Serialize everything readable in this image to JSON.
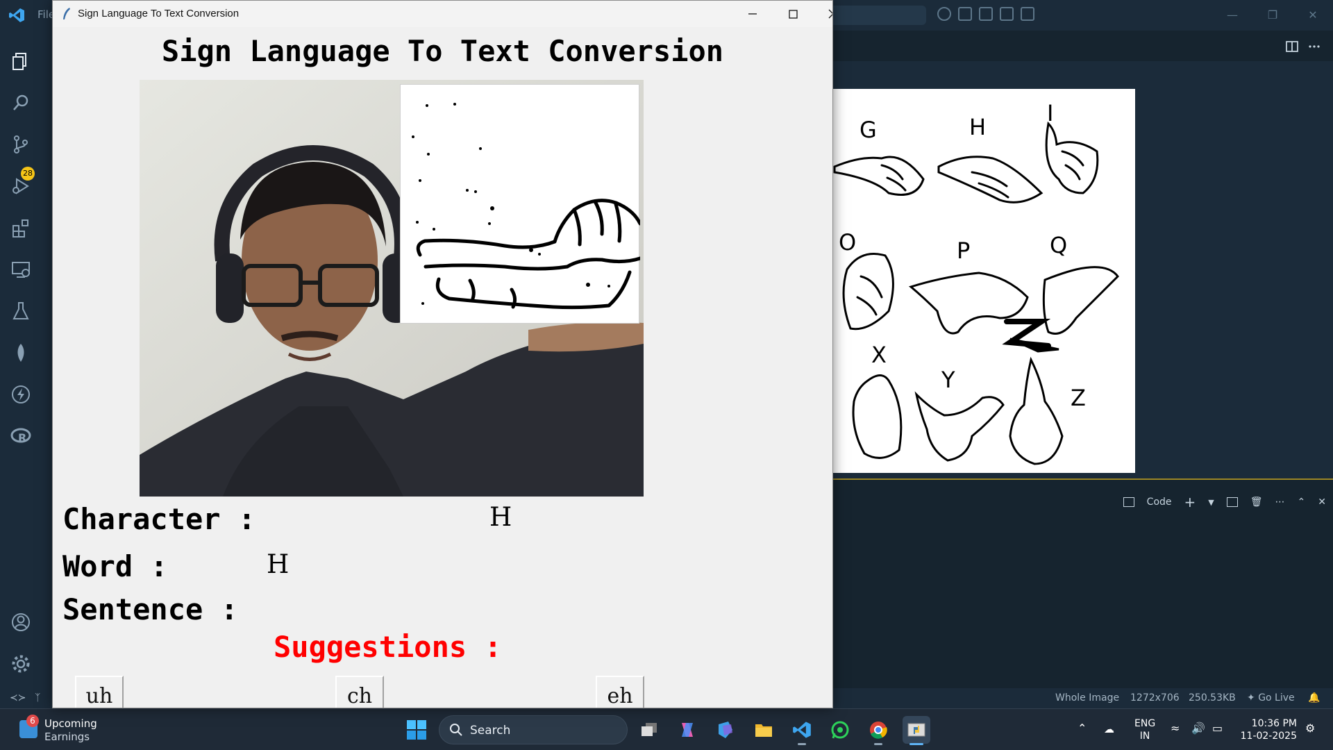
{
  "vscode": {
    "menu_label": "File",
    "badge_count": "28",
    "panel": {
      "code_label": "Code"
    },
    "status": {
      "image_label": "Whole Image",
      "dimensions": "1272x706",
      "size": "250.53KB",
      "go_live": "Go Live"
    },
    "preview_letters": [
      "G",
      "H",
      "I",
      "O",
      "P",
      "Q",
      "X",
      "Y",
      "Z"
    ]
  },
  "app": {
    "window_title": "Sign Language To Text Conversion",
    "heading": "Sign Language To Text Conversion",
    "character_label": "Character :",
    "character_value": "H",
    "word_label": "Word :",
    "word_value": "H",
    "sentence_label": "Sentence :",
    "sentence_value": "",
    "suggestions_label": "Suggestions :",
    "suggestions": [
      "uh",
      "ch",
      "eh"
    ],
    "colors": {
      "suggestions": "#ff0000",
      "window_bg": "#f0f0f0"
    }
  },
  "taskbar": {
    "weather_badge": "6",
    "weather_line1": "Upcoming",
    "weather_line2": "Earnings",
    "search_label": "Search",
    "lang_line1": "ENG",
    "lang_line2": "IN",
    "time": "10:36 PM",
    "date": "11-02-2025"
  }
}
